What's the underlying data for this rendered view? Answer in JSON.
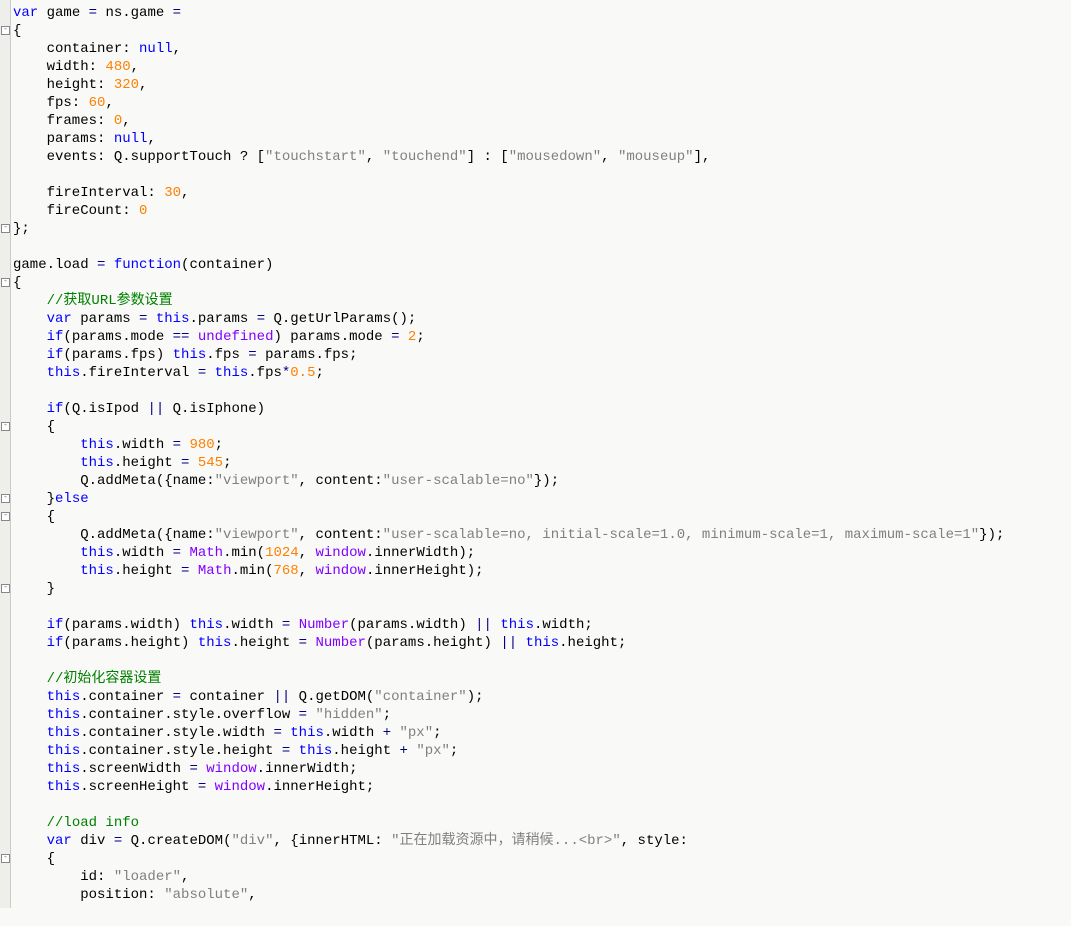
{
  "lines": [
    {
      "html": "<span class='kw'>var</span> game <span class='op'>=</span> ns.game <span class='op'>=</span>"
    },
    {
      "html": "{",
      "fold": true
    },
    {
      "html": "    container: <span class='kw'>null</span>,"
    },
    {
      "html": "    width: <span class='num'>480</span>,"
    },
    {
      "html": "    height: <span class='num'>320</span>,"
    },
    {
      "html": "    fps: <span class='num'>60</span>,"
    },
    {
      "html": "    frames: <span class='num'>0</span>,"
    },
    {
      "html": "    params: <span class='kw'>null</span>,"
    },
    {
      "html": "    events: Q.supportTouch ? [<span class='str'>\"touchstart\"</span>, <span class='str'>\"touchend\"</span>] : [<span class='str'>\"mousedown\"</span>, <span class='str'>\"mouseup\"</span>],"
    },
    {
      "html": ""
    },
    {
      "html": "    fireInterval: <span class='num'>30</span>,"
    },
    {
      "html": "    fireCount: <span class='num'>0</span>"
    },
    {
      "html": "};",
      "foldend": true
    },
    {
      "html": ""
    },
    {
      "html": "game.load <span class='op'>=</span> <span class='kw'>function</span>(container)"
    },
    {
      "html": "{",
      "fold": true
    },
    {
      "html": "    <span class='com'>//获取URL参数设置</span>"
    },
    {
      "html": "    <span class='kw'>var</span> params <span class='op'>=</span> <span class='kw'>this</span>.params <span class='op'>=</span> Q.getUrlParams();"
    },
    {
      "html": "    <span class='kw'>if</span>(params.mode <span class='op'>==</span> <span class='glb'>undefined</span>) params.mode <span class='op'>=</span> <span class='num'>2</span>;"
    },
    {
      "html": "    <span class='kw'>if</span>(params.fps) <span class='kw'>this</span>.fps <span class='op'>=</span> params.fps;"
    },
    {
      "html": "    <span class='kw'>this</span>.fireInterval <span class='op'>=</span> <span class='kw'>this</span>.fps<span class='op'>*</span><span class='num'>0.5</span>;"
    },
    {
      "html": ""
    },
    {
      "html": "    <span class='kw'>if</span>(Q.isIpod <span class='op'>||</span> Q.isIphone)"
    },
    {
      "html": "    {",
      "fold": true
    },
    {
      "html": "        <span class='kw'>this</span>.width <span class='op'>=</span> <span class='num'>980</span>;"
    },
    {
      "html": "        <span class='kw'>this</span>.height <span class='op'>=</span> <span class='num'>545</span>;"
    },
    {
      "html": "        Q.addMeta({name:<span class='str'>\"viewport\"</span>, content:<span class='str'>\"user-scalable=no\"</span>});"
    },
    {
      "html": "    }<span class='kw'>else</span>",
      "foldend": true
    },
    {
      "html": "    {",
      "fold": true
    },
    {
      "html": "        Q.addMeta({name:<span class='str'>\"viewport\"</span>, content:<span class='str'>\"user-scalable=no, initial-scale=1.0, minimum-scale=1, maximum-scale=1\"</span>});"
    },
    {
      "html": "        <span class='kw'>this</span>.width <span class='op'>=</span> <span class='glb'>Math</span>.min(<span class='num'>1024</span>, <span class='glb'>window</span>.innerWidth);"
    },
    {
      "html": "        <span class='kw'>this</span>.height <span class='op'>=</span> <span class='glb'>Math</span>.min(<span class='num'>768</span>, <span class='glb'>window</span>.innerHeight);"
    },
    {
      "html": "    }",
      "foldend": true
    },
    {
      "html": ""
    },
    {
      "html": "    <span class='kw'>if</span>(params.width) <span class='kw'>this</span>.width <span class='op'>=</span> <span class='glb'>Number</span>(params.width) <span class='op'>||</span> <span class='kw'>this</span>.width;"
    },
    {
      "html": "    <span class='kw'>if</span>(params.height) <span class='kw'>this</span>.height <span class='op'>=</span> <span class='glb'>Number</span>(params.height) <span class='op'>||</span> <span class='kw'>this</span>.height;"
    },
    {
      "html": ""
    },
    {
      "html": "    <span class='com'>//初始化容器设置</span>"
    },
    {
      "html": "    <span class='kw'>this</span>.container <span class='op'>=</span> container <span class='op'>||</span> Q.getDOM(<span class='str'>\"container\"</span>);"
    },
    {
      "html": "    <span class='kw'>this</span>.container.style.overflow <span class='op'>=</span> <span class='str'>\"hidden\"</span>;"
    },
    {
      "html": "    <span class='kw'>this</span>.container.style.width <span class='op'>=</span> <span class='kw'>this</span>.width <span class='op'>+</span> <span class='str'>\"px\"</span>;"
    },
    {
      "html": "    <span class='kw'>this</span>.container.style.height <span class='op'>=</span> <span class='kw'>this</span>.height <span class='op'>+</span> <span class='str'>\"px\"</span>;"
    },
    {
      "html": "    <span class='kw'>this</span>.screenWidth <span class='op'>=</span> <span class='glb'>window</span>.innerWidth;"
    },
    {
      "html": "    <span class='kw'>this</span>.screenHeight <span class='op'>=</span> <span class='glb'>window</span>.innerHeight;"
    },
    {
      "html": ""
    },
    {
      "html": "    <span class='com'>//load info</span>"
    },
    {
      "html": "    <span class='kw'>var</span> div <span class='op'>=</span> Q.createDOM(<span class='str'>\"div\"</span>, {innerHTML: <span class='str'>\"正在加载资源中，请稍候...&lt;br&gt;\"</span>, style:"
    },
    {
      "html": "    {",
      "fold": true
    },
    {
      "html": "        id: <span class='str'>\"loader\"</span>,"
    },
    {
      "html": "        position: <span class='str'>\"absolute\"</span>,"
    }
  ]
}
